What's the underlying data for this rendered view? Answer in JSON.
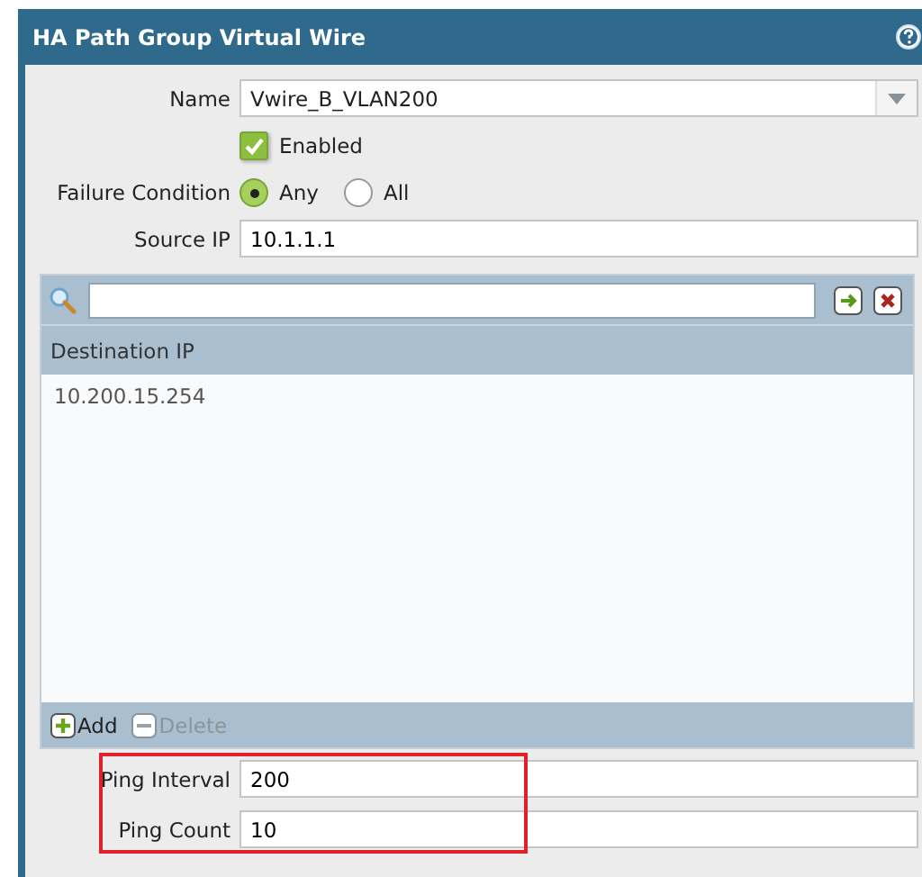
{
  "window": {
    "title": "HA Path Group Virtual Wire"
  },
  "name_field": {
    "label": "Name",
    "value": "Vwire_B_VLAN200"
  },
  "enabled": {
    "label": "Enabled",
    "checked": true
  },
  "failure_condition": {
    "label": "Failure Condition",
    "options": [
      {
        "label": "Any",
        "selected": true
      },
      {
        "label": "All",
        "selected": false
      }
    ]
  },
  "source_ip": {
    "label": "Source IP",
    "value": "10.1.1.1"
  },
  "table": {
    "columns": [
      "Destination IP"
    ],
    "rows": [
      [
        "10.200.15.254"
      ]
    ],
    "actions": [
      {
        "kind": "add",
        "label": "Add",
        "disabled": false
      },
      {
        "kind": "delete",
        "label": "Delete",
        "disabled": true
      }
    ]
  },
  "ping_settings": {
    "highlighted": true,
    "fields": [
      {
        "label": "Ping Interval",
        "value": "200"
      },
      {
        "label": "Ping Count",
        "value": "10"
      }
    ]
  }
}
